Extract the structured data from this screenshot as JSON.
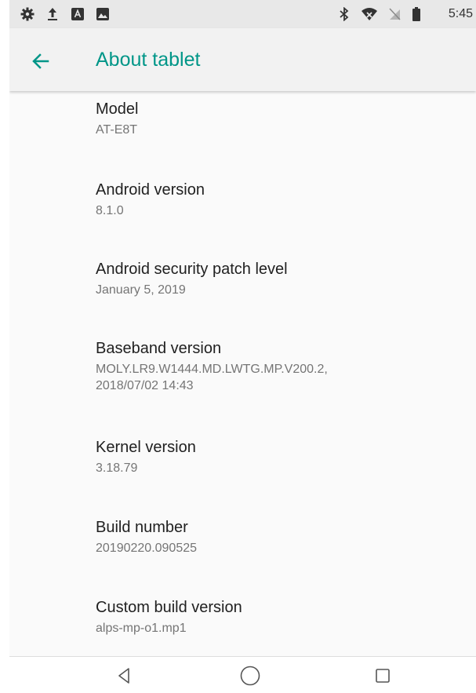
{
  "status_bar": {
    "time": "5:45",
    "left_icons": [
      "gear-icon",
      "upload-icon",
      "notification-a-icon",
      "image-icon"
    ],
    "right_icons": [
      "bluetooth-icon",
      "wifi-icon",
      "no-sim-icon",
      "battery-icon"
    ]
  },
  "app_bar": {
    "title": "About tablet",
    "accent_color": "#009688"
  },
  "items": [
    {
      "title": "Model",
      "summary": "AT-E8T"
    },
    {
      "title": "Android version",
      "summary": "8.1.0"
    },
    {
      "title": "Android security patch level",
      "summary": "January 5, 2019"
    },
    {
      "title": "Baseband version",
      "summary_lines": [
        "MOLY.LR9.W1444.MD.LWTG.MP.V200.2,",
        "2018/07/02 14:43"
      ]
    },
    {
      "title": "Kernel version",
      "summary": "3.18.79"
    },
    {
      "title": "Build number",
      "summary": "20190220.090525"
    },
    {
      "title": "Custom build version",
      "summary": "alps-mp-o1.mp1"
    }
  ],
  "nav_bar": {
    "buttons": [
      "back-icon",
      "home-icon",
      "recents-icon"
    ]
  }
}
